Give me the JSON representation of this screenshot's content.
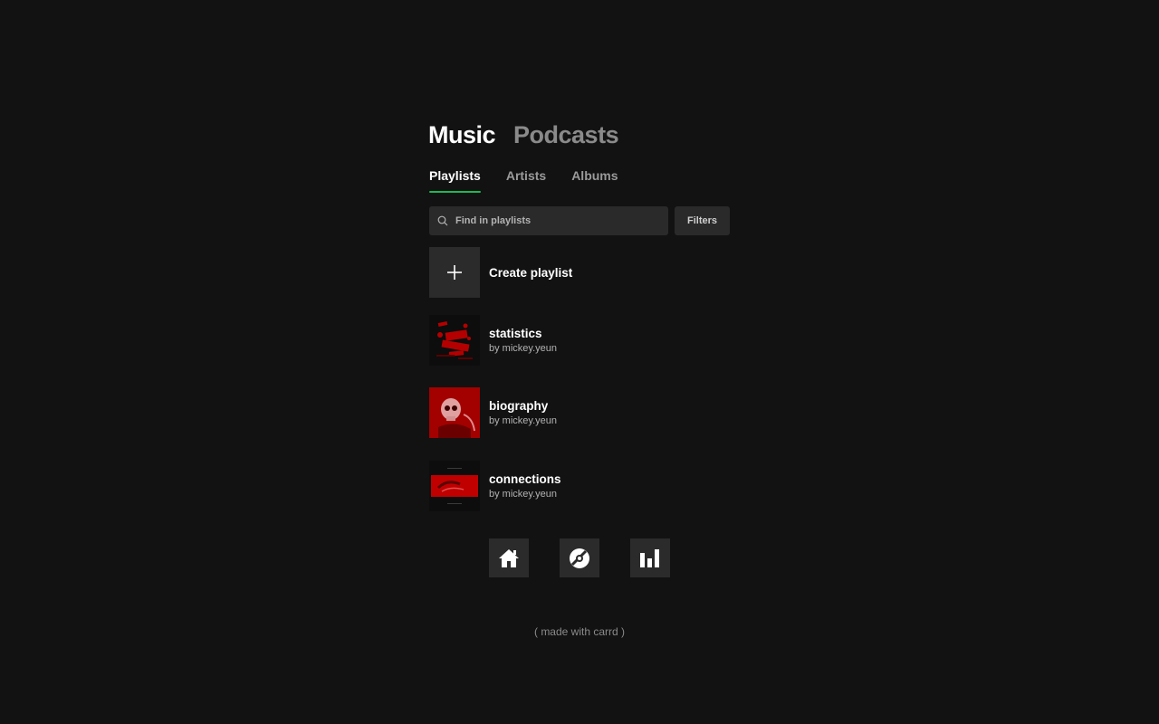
{
  "main_tabs": [
    {
      "label": "Music",
      "active": true
    },
    {
      "label": "Podcasts",
      "active": false
    }
  ],
  "sub_tabs": [
    {
      "label": "Playlists",
      "active": true
    },
    {
      "label": "Artists",
      "active": false
    },
    {
      "label": "Albums",
      "active": false
    }
  ],
  "search": {
    "placeholder": "Find in playlists",
    "icon": "search-icon"
  },
  "filters_label": "Filters",
  "create": {
    "label": "Create playlist",
    "icon": "plus-icon"
  },
  "playlists": [
    {
      "title": "statistics",
      "owner": "by mickey.yeun"
    },
    {
      "title": "biography",
      "owner": "by mickey.yeun"
    },
    {
      "title": "connections",
      "owner": "by mickey.yeun"
    }
  ],
  "nav_icons": [
    "home-icon",
    "disc-icon",
    "chart-icon"
  ],
  "footer": "( made with carrd )",
  "colors": {
    "background": "#121212",
    "accent": "#1db954",
    "tile": "#2a2a2a",
    "cover_red": "#c00000"
  }
}
